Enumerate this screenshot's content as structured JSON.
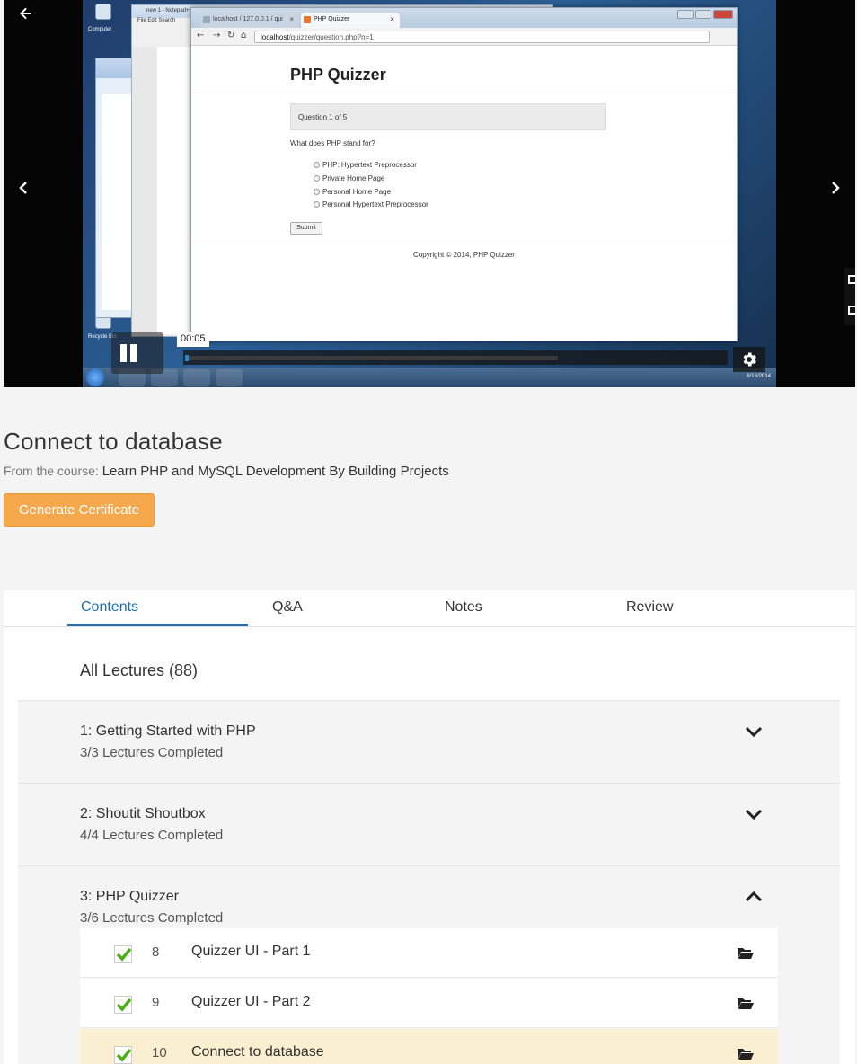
{
  "player": {
    "current_time": "00:05",
    "played_fraction": 0.003,
    "buffered_fraction": 0.69,
    "accent_color": "#1a8bd6",
    "icons": {
      "back": "arrow-left-icon",
      "prev": "chevron-left-icon",
      "next": "chevron-right-icon",
      "pause": "pause-icon",
      "settings": "gear-icon"
    },
    "screencast": {
      "desktop_icons": [
        "Computer",
        "Recycle Bin"
      ],
      "notepad_title": "new 1 - Notepad++",
      "notepad_menu": "File  Edit  Search",
      "browser_tabs": [
        "localhost / 127.0.0.1 / qui",
        "PHP Quizzer"
      ],
      "url_host": "localhost",
      "url_path": "/quizzer/question.php?n=1",
      "page_title": "PHP Quizzer",
      "question_counter": "Question 1 of 5",
      "question": "What does PHP stand for?",
      "options": [
        "PHP: Hypertext Preprocessor",
        "Private Home Page",
        "Personal Home Page",
        "Personal Hypertext Preprocessor"
      ],
      "submit_label": "Submit",
      "copyright": "Copyright © 2014, PHP Quizzer",
      "taskbar_date": "6/16/2014"
    }
  },
  "lecture": {
    "title": "Connect to database",
    "from_label": "From the course:",
    "course_name": "Learn PHP and MySQL Development By Building Projects",
    "certificate_button": "Generate Certificate",
    "certificate_color": "#f6a84d"
  },
  "tabs": {
    "active_color": "#1f6fb0",
    "items": [
      {
        "label": "Contents",
        "active": true
      },
      {
        "label": "Q&A",
        "active": false
      },
      {
        "label": "Notes",
        "active": false
      },
      {
        "label": "Review",
        "active": false
      }
    ]
  },
  "contents": {
    "heading": "All Lectures (88)",
    "sections": [
      {
        "title": "1: Getting Started with PHP",
        "progress": "3/3 Lectures Completed",
        "expanded": false
      },
      {
        "title": "2: Shoutit Shoutbox",
        "progress": "4/4 Lectures Completed",
        "expanded": false
      },
      {
        "title": "3: PHP Quizzer",
        "progress": "3/6 Lectures Completed",
        "expanded": true
      }
    ],
    "lectures": [
      {
        "number": "8",
        "name": "Quizzer UI - Part 1",
        "completed": true,
        "current": false
      },
      {
        "number": "9",
        "name": "Quizzer UI - Part 2",
        "completed": true,
        "current": false
      },
      {
        "number": "10",
        "name": "Connect to database",
        "completed": true,
        "current": true
      }
    ],
    "check_color": "#4caf1a",
    "current_row_color": "#fbefd1"
  }
}
